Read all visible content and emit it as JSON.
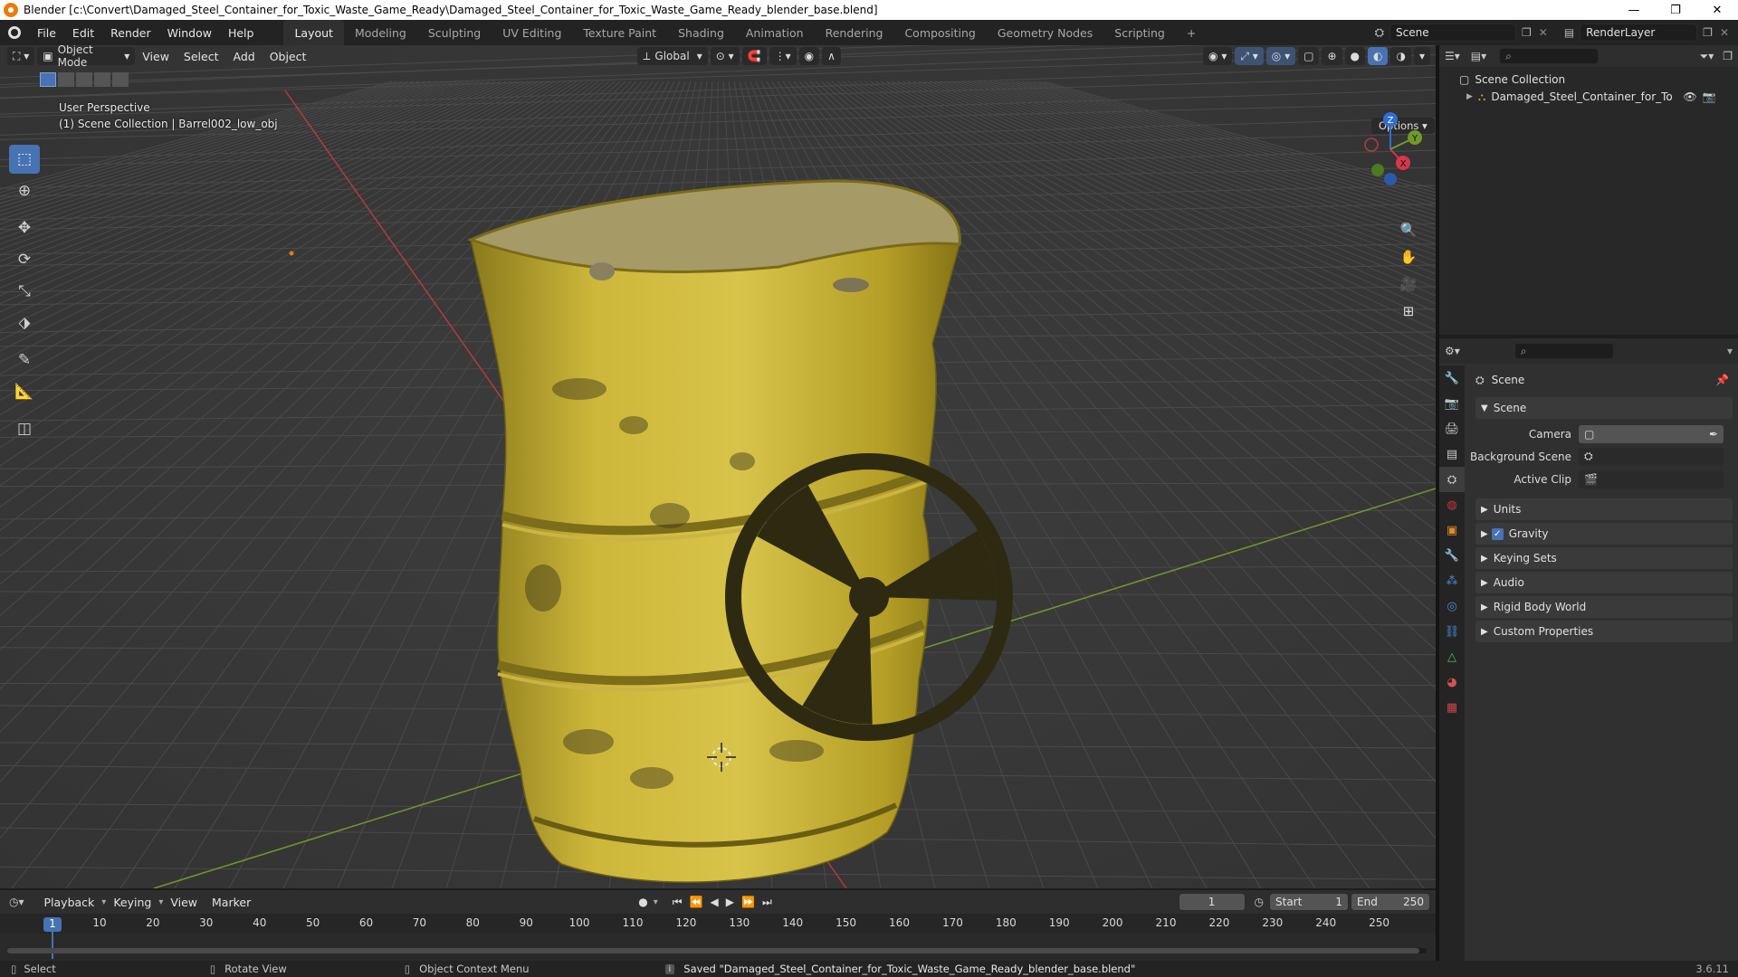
{
  "window": {
    "title": "Blender [c:\\Convert\\Damaged_Steel_Container_for_Toxic_Waste_Game_Ready\\Damaged_Steel_Container_for_Toxic_Waste_Game_Ready_blender_base.blend]",
    "minimize": "—",
    "maximize": "❐",
    "close": "✕"
  },
  "topbar": {
    "menus": [
      "File",
      "Edit",
      "Render",
      "Window",
      "Help"
    ],
    "workspaces": [
      "Layout",
      "Modeling",
      "Sculpting",
      "UV Editing",
      "Texture Paint",
      "Shading",
      "Animation",
      "Rendering",
      "Compositing",
      "Geometry Nodes",
      "Scripting"
    ],
    "add_ws": "+",
    "scene": "Scene",
    "view_layer": "RenderLayer"
  },
  "viewport": {
    "mode": "Object Mode",
    "menus": [
      "View",
      "Select",
      "Add",
      "Object"
    ],
    "orientation": "Global",
    "options": "Options",
    "perspective": "User Perspective",
    "collection_info": "(1) Scene Collection | Barrel002_low_obj",
    "gizmo": {
      "x": "X",
      "y": "Y",
      "z": "Z"
    }
  },
  "outliner": {
    "root": "Scene Collection",
    "item": "Damaged_Steel_Container_for_Toxic_W"
  },
  "properties": {
    "title": "Scene",
    "panel": "Scene",
    "camera_label": "Camera",
    "bg_label": "Background Scene",
    "clip_label": "Active Clip",
    "sections": [
      "Units",
      "Gravity",
      "Keying Sets",
      "Audio",
      "Rigid Body World",
      "Custom Properties"
    ]
  },
  "timeline": {
    "menus": [
      "Playback",
      "Keying",
      "View",
      "Marker"
    ],
    "current_frame": "1",
    "start_label": "Start",
    "start": "1",
    "end_label": "End",
    "end": "250",
    "ticks": [
      "10",
      "20",
      "30",
      "40",
      "50",
      "60",
      "70",
      "80",
      "90",
      "100",
      "110",
      "120",
      "130",
      "140",
      "150",
      "160",
      "170",
      "180",
      "190",
      "200",
      "210",
      "220",
      "230",
      "240",
      "250"
    ]
  },
  "status": {
    "select": "Select",
    "rotate": "Rotate View",
    "context": "Object Context Menu",
    "saved": "Saved \"Damaged_Steel_Container_for_Toxic_Waste_Game_Ready_blender_base.blend\"",
    "version": "3.6.11"
  },
  "colors": {
    "accent": "#4772b3",
    "barrel": "#c8b02a",
    "x_axis": "#b53a3f",
    "y_axis": "#6f9a2a"
  }
}
